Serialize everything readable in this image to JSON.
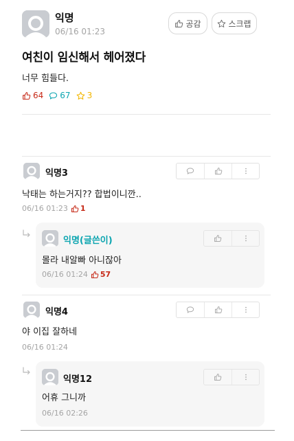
{
  "post": {
    "author": "익명",
    "time": "06/16 01:23",
    "title": "여친이 임신해서 헤어졌다",
    "body": "너무 힘들다.",
    "likes": "64",
    "comments": "67",
    "scraps": "3",
    "like_button": "공감",
    "scrap_button": "스크랩"
  },
  "comments": [
    {
      "author": "익명3",
      "text": "낙태는 하는거지?? 합법이니깐..",
      "time": "06/16 01:23",
      "likes": "1",
      "reply": {
        "author": "익명(글쓴이)",
        "text": "몰라 내알빠 아니잖아",
        "time": "06/16 01:24",
        "likes": "57"
      }
    },
    {
      "author": "익명4",
      "text": "야 이집 잘하네",
      "time": "06/16 01:24",
      "reply": {
        "author": "익명12",
        "text": "어휴 그니까",
        "time": "06/16 02:26"
      }
    }
  ],
  "icons": {
    "like": "thumbs-up-icon",
    "comment": "speech-bubble-icon",
    "scrap": "star-icon",
    "more": "more-vertical-icon",
    "reply": "reply-arrow-icon",
    "avatar": "default-profile-icon"
  },
  "colors": {
    "like": "#c62917",
    "comment": "#0ca5b0",
    "scrap": "#f2b600",
    "writer": "#0ca5b0",
    "meta": "#a4a4a4"
  }
}
